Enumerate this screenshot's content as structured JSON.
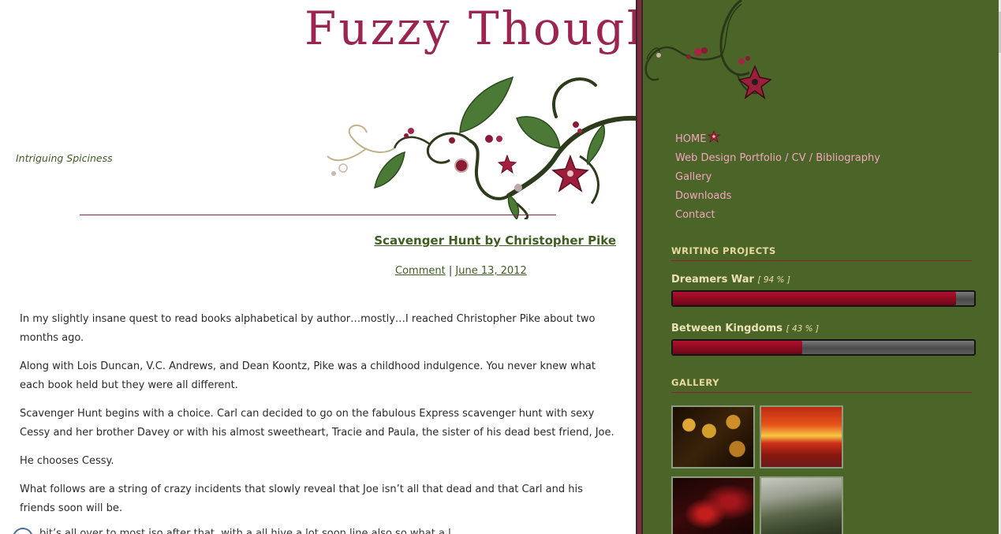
{
  "header": {
    "site_title": "Fuzzy Thoughts",
    "tagline": "Intriguing Spiciness"
  },
  "post": {
    "title": "Scavenger Hunt by Christopher Pike",
    "comment_link": "Comment",
    "separator": "|",
    "date": "June 13, 2012",
    "paragraphs": [
      "In my slightly insane quest to read books alphabetical by author…mostly…I reached Christopher Pike about two months ago.",
      "Along with Lois Duncan, V.C. Andrews, and Dean Koontz, Pike was a childhood indulgence. You never knew what each book held but they were all different.",
      "Scavenger Hunt begins with a choice. Carl can decided to go on the fabulous Express scavenger hunt with sexy Cessy and her brother Davey or with his almost sweetheart, Tracie and Paula, the sister of his dead best friend, Joe.",
      "He chooses Cessy.",
      "What follows are a string of crazy incidents that slowly reveal that Joe isn’t all that dead and that Carl and his friends soon will be."
    ],
    "cut_line": "bit’s all over to most iso after that, with a all hive a lot soon line also so what a l"
  },
  "nav": {
    "items": [
      {
        "label": "HOME"
      },
      {
        "label": "Web Design Portfolio / CV / Bibliography"
      },
      {
        "label": "Gallery"
      },
      {
        "label": "Downloads"
      },
      {
        "label": "Contact"
      }
    ]
  },
  "writing_projects": {
    "heading": "WRITING PROJECTS",
    "projects": [
      {
        "name": "Dreamers War",
        "pct_text": "[ 94 % ]",
        "progress": 94
      },
      {
        "name": "Between Kingdoms",
        "pct_text": "[ 43 % ]",
        "progress": 43
      }
    ]
  },
  "gallery": {
    "heading": "GALLERY",
    "thumbnails": [
      "golden-orbs-fairy",
      "fiery-sunset-reflection",
      "red-abstract-streaks",
      "misty-forest-path"
    ]
  },
  "colors": {
    "sidebar_bg": "#4b6427",
    "title_magenta": "#9b2450",
    "link_green": "#3f5c22",
    "nav_pink": "#f2a6be",
    "progress_red": "#8a0a20"
  }
}
